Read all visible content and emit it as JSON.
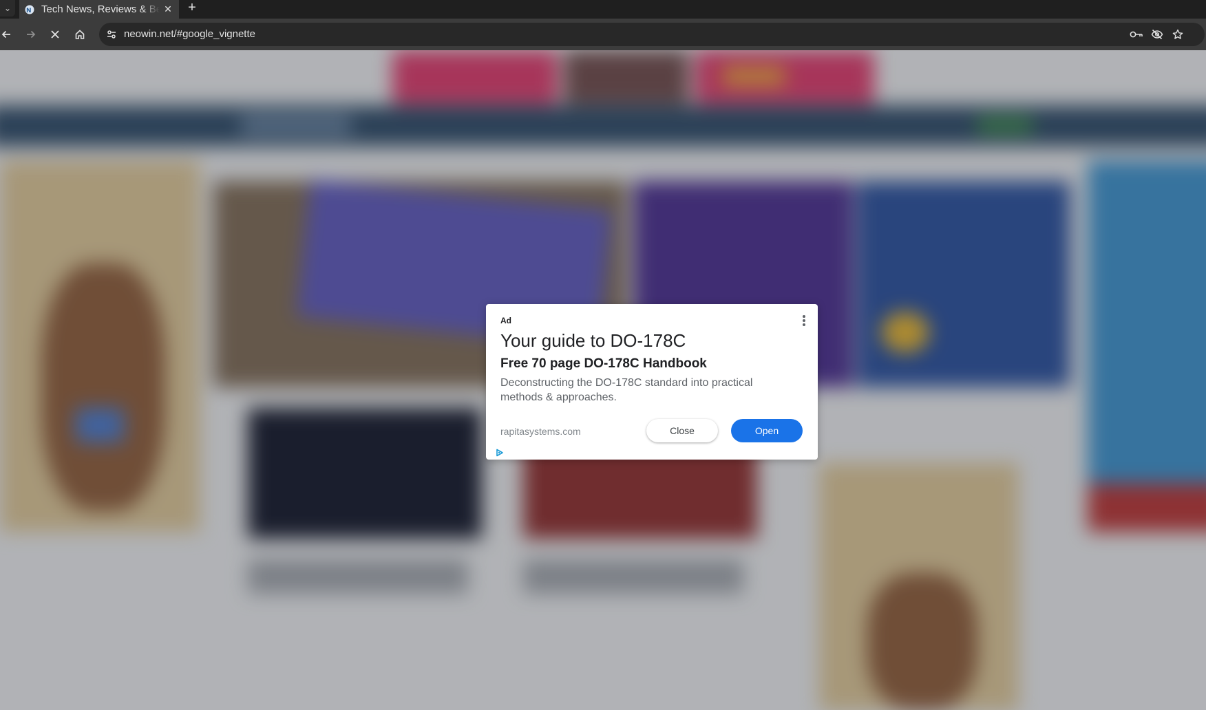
{
  "browser": {
    "tab": {
      "title": "Tech News, Reviews & Betas",
      "close_glyph": "✕"
    },
    "new_tab_glyph": "+",
    "tab_list_glyph": "⌄",
    "address": {
      "url": "neowin.net/#google_vignette"
    },
    "icons": [
      "back-icon",
      "forward-icon",
      "stop-icon",
      "home-icon",
      "site-info-icon",
      "password-key-icon",
      "tracking-protection-icon",
      "bookmark-star-icon"
    ]
  },
  "ad": {
    "label": "Ad",
    "headline": "Your guide to DO-178C",
    "subheadline": "Free 70 page DO-178C Handbook",
    "description": "Deconstructing the DO-178C standard into practical methods & approaches.",
    "domain": "rapitasystems.com",
    "close_label": "Close",
    "open_label": "Open",
    "accent_color": "#1a73e8"
  }
}
